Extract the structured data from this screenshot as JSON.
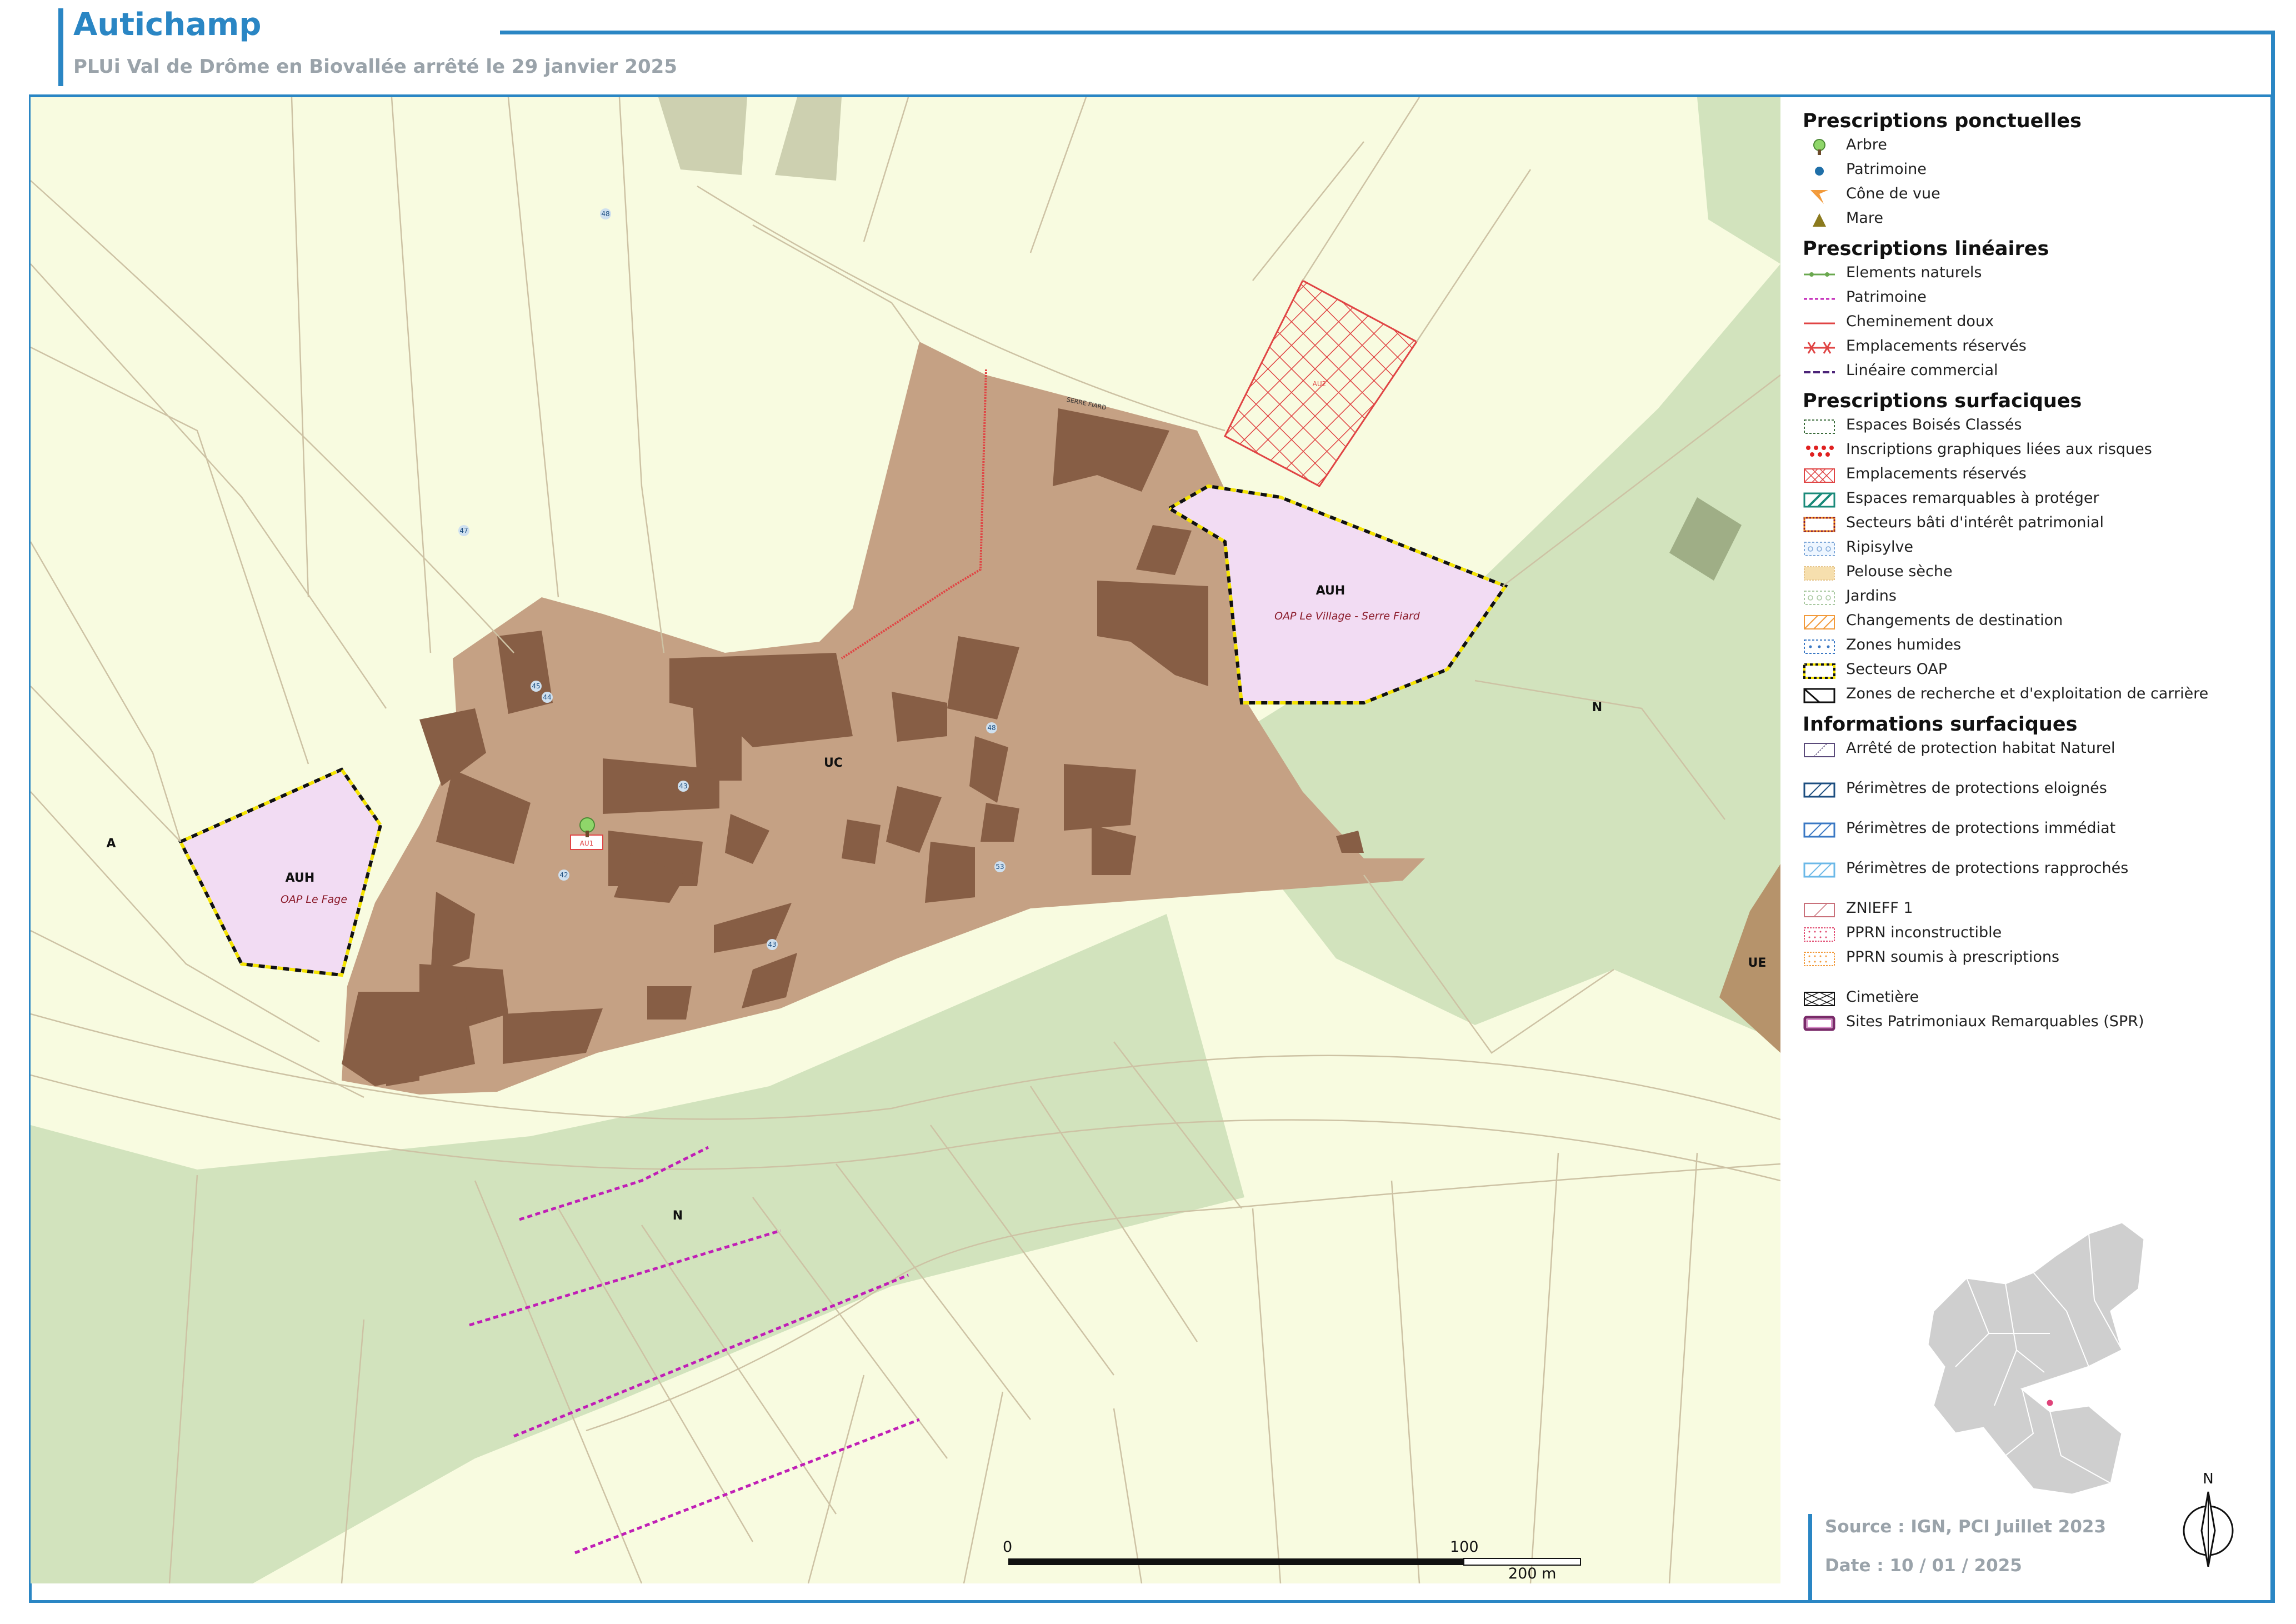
{
  "title": "Autichamp",
  "subtitle": "PLUi Val de Drôme en Biovallée arrêté le 29 janvier 2025",
  "map": {
    "zone_labels": [
      "AUH",
      "AUH",
      "UC",
      "A",
      "N",
      "N",
      "UE"
    ],
    "oap_labels": [
      "OAP Le Fage",
      "OAP Le Village - Serre Fiard"
    ],
    "reserved_codes": [
      "AU1",
      "AU2"
    ],
    "road_labels": [
      "48",
      "47",
      "45",
      "48",
      "42",
      "43",
      "44",
      "53",
      "43"
    ],
    "place_label": "SERRE FIARD",
    "colors": {
      "agricultural": "#f8fbe0",
      "natural": "#d2e3bd",
      "urban": "#c5a184",
      "buildings": "#875e45",
      "oap": "#f2dcf3",
      "economic": "#b6936b",
      "parcel_lines": "#cdc2a4"
    }
  },
  "legend": {
    "sections": [
      {
        "heading": "Prescriptions ponctuelles",
        "items": [
          {
            "label": "Arbre",
            "symbol": "tree-icon"
          },
          {
            "label": "Patrimoine",
            "symbol": "dot-icon"
          },
          {
            "label": "Cône de vue",
            "symbol": "view-cone-icon"
          },
          {
            "label": "Mare",
            "symbol": "triangle-icon"
          }
        ]
      },
      {
        "heading": "Prescriptions linéaires",
        "items": [
          {
            "label": "Elements naturels",
            "symbol": "line-green-dot"
          },
          {
            "label": "Patrimoine",
            "symbol": "line-magenta-dash"
          },
          {
            "label": "Cheminement doux",
            "symbol": "line-red"
          },
          {
            "label": "Emplacements réservés",
            "symbol": "line-red-cross"
          },
          {
            "label": "Linéaire commercial",
            "symbol": "line-purple-dash"
          }
        ]
      },
      {
        "heading": "Prescriptions surfaciques",
        "items": [
          {
            "label": "Espaces Boisés Classés",
            "symbol": "box-dashed-green"
          },
          {
            "label": "Inscriptions graphiques liées aux risques",
            "symbol": "box-red-dots"
          },
          {
            "label": "Emplacements réservés",
            "symbol": "box-red-hatch"
          },
          {
            "label": "Espaces remarquables à protéger",
            "symbol": "box-teal-hatch"
          },
          {
            "label": "Secteurs bâti d'intérêt patrimonial",
            "symbol": "box-orange-dotted"
          },
          {
            "label": "Ripisylve",
            "symbol": "box-blue-circles"
          },
          {
            "label": "Pelouse sèche",
            "symbol": "box-tan-fill"
          },
          {
            "label": "Jardins",
            "symbol": "box-green-circles"
          },
          {
            "label": "Changements de destination",
            "symbol": "box-orange-hatch"
          },
          {
            "label": "Zones humides",
            "symbol": "box-blue-dots"
          },
          {
            "label": "Secteurs OAP",
            "symbol": "box-yellow-black"
          },
          {
            "label": "Zones de recherche et d'exploitation de carrière",
            "symbol": "box-black-diag"
          }
        ]
      },
      {
        "heading": "Informations surfaciques",
        "items": [
          {
            "label": "Arrêté de protection habitat Naturel",
            "symbol": "box-purple-diag",
            "tall": true
          },
          {
            "label": "Périmètres de protections eloignés",
            "symbol": "box-navy-diag",
            "tall": true
          },
          {
            "label": "Périmètres de protections immédiat",
            "symbol": "box-blue-diag",
            "tall": true
          },
          {
            "label": "Périmètres de protections rapprochés",
            "symbol": "box-sky-diag",
            "tall": true
          },
          {
            "label": "ZNIEFF 1",
            "symbol": "box-pink-diag"
          },
          {
            "label": "PPRN inconstructible",
            "symbol": "box-red-grid"
          },
          {
            "label": "PPRN soumis à prescriptions",
            "symbol": "box-orange-grid",
            "tall": true
          },
          {
            "label": "Cimetière",
            "symbol": "box-black-cross"
          },
          {
            "label": "Sites Patrimoniaux Remarquables (SPR)",
            "symbol": "box-spr"
          }
        ]
      }
    ]
  },
  "scale": {
    "labels": [
      "0",
      "100",
      "200 m"
    ]
  },
  "source": "Source : IGN, PCI Juillet 2023",
  "date": "Date : 10 / 01 / 2025",
  "north_label": "N"
}
